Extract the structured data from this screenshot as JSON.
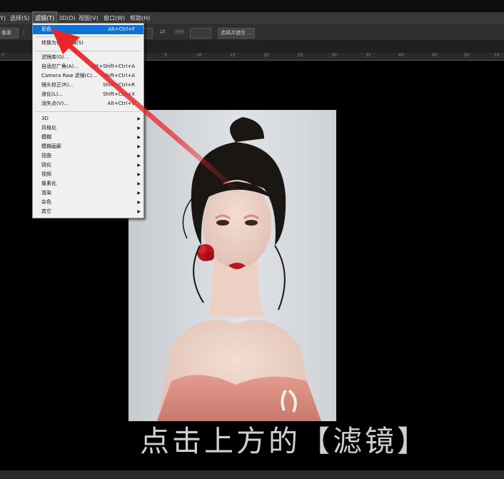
{
  "menu": {
    "items": [
      "Y)",
      "选择(S)",
      "滤镜(T)",
      "3D(D)",
      "视图(V)",
      "窗口(W)",
      "帮助(H)"
    ],
    "active_index": 2
  },
  "options_bar": {
    "left_label": "像素",
    "smooth_label": "消除",
    "select_mask_button": "选择并遮住 ..."
  },
  "ruler": {
    "labels": [
      "0",
      "5",
      "10",
      "15",
      "20",
      "25",
      "30",
      "35",
      "40",
      "45",
      "50",
      "55"
    ]
  },
  "filter_menu": {
    "last_filter": {
      "label": "彩色...",
      "shortcut": "Alt+Ctrl+F"
    },
    "convert_smart": "转换为智能滤镜(S)",
    "group2": [
      {
        "label": "滤镜库(G)...",
        "shortcut": ""
      },
      {
        "label": "自适应广角(A)...",
        "shortcut": "Alt+Shift+Ctrl+A"
      },
      {
        "label": "Camera Raw 滤镜(C)...",
        "shortcut": "Shift+Ctrl+A"
      },
      {
        "label": "镜头校正(R)...",
        "shortcut": "Shift+Ctrl+R"
      },
      {
        "label": "液化(L)...",
        "shortcut": "Shift+Ctrl+X"
      },
      {
        "label": "消失点(V)...",
        "shortcut": "Alt+Ctrl+V"
      }
    ],
    "submenus": [
      "3D",
      "风格化",
      "模糊",
      "模糊画廊",
      "扭曲",
      "锐化",
      "视频",
      "像素化",
      "渲染",
      "杂色",
      "其它"
    ]
  },
  "caption": "点击上方的【滤镜】",
  "colors": {
    "arrow": "#e8262a",
    "highlight": "#0a72d8",
    "menu_bg": "#f0f0f0"
  }
}
